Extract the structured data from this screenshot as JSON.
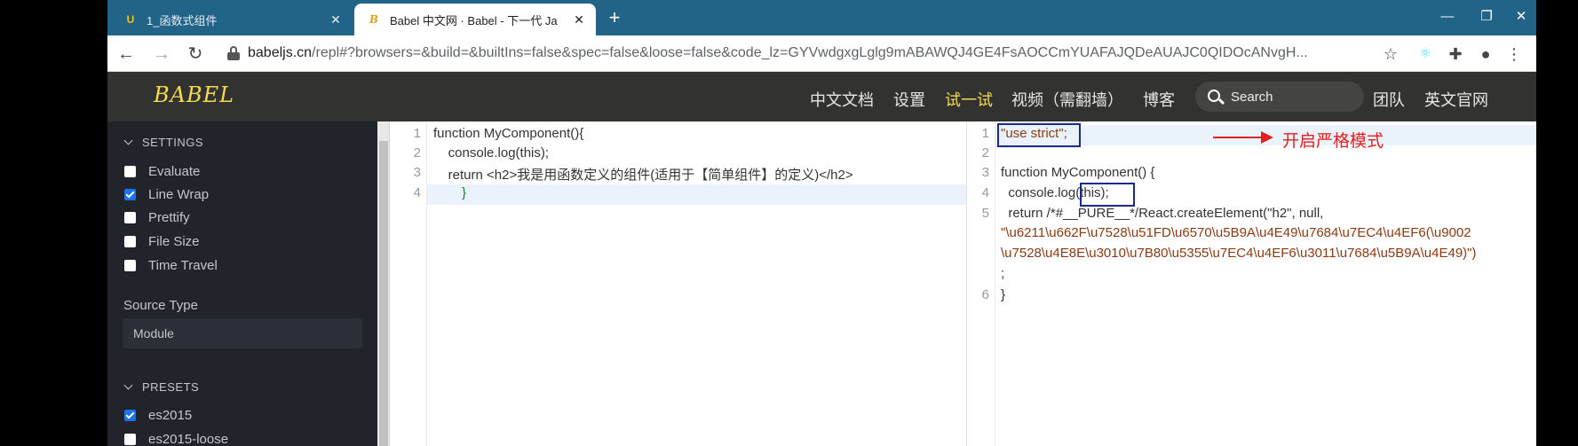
{
  "browser": {
    "tabs": [
      {
        "favicon": "U",
        "title": "1_函数式组件",
        "close": "✕"
      },
      {
        "favicon": "B",
        "title": "Babel 中文网 · Babel - 下一代 Ja",
        "close": "✕"
      }
    ],
    "new_tab": "+",
    "window_controls": {
      "minimize": "—",
      "restore": "❐",
      "close": "✕"
    },
    "url_host": "babeljs.cn",
    "url_path": "/repl#?browsers=&build=&builtIns=false&spec=false&loose=false&code_lz=GYVwdgxgLglg9mABAWQJ4GE4FsAOCCmYUAFAJQDeAUAJC0QIDOcANvgH..."
  },
  "site": {
    "logo": "BABEL",
    "nav": [
      "中文文档",
      "设置",
      "试一试",
      "视频（需翻墙）",
      "博客",
      "团队",
      "英文官网"
    ],
    "active_nav": "试一试",
    "search_placeholder": "Search"
  },
  "sidebar": {
    "settings_title": "SETTINGS",
    "settings": [
      {
        "label": "Evaluate",
        "checked": false
      },
      {
        "label": "Line Wrap",
        "checked": true
      },
      {
        "label": "Prettify",
        "checked": false
      },
      {
        "label": "File Size",
        "checked": false
      },
      {
        "label": "Time Travel",
        "checked": false
      }
    ],
    "source_type_label": "Source Type",
    "source_type_value": "Module",
    "presets_title": "PRESETS",
    "presets": [
      {
        "label": "es2015",
        "checked": true
      },
      {
        "label": "es2015-loose",
        "checked": false
      }
    ]
  },
  "input_editor": {
    "line_numbers": [
      "1",
      "2",
      "3",
      "4"
    ],
    "lines": [
      "function MyComponent(){",
      "    console.log(this);",
      "    return <h2>我是用函数定义的组件(适用于【简单组件】的定义)</h2>",
      "}"
    ]
  },
  "output_editor": {
    "line_numbers": [
      "1",
      "2",
      "3",
      "4",
      "5",
      "6"
    ],
    "lines": [
      "\"use strict\";",
      "",
      "function MyComponent() {",
      "  console.log(this);",
      "  return /*#__PURE__*/React.createElement(\"h2\", null,",
      "\"\\u6211\\u662F\\u7528\\u51FD\\u6570\\u5B9A\\u4E49\\u7684\\u7EC4\\u4EF6(\\u9002",
      "\\u7528\\u4E8E\\u3010\\u7B80\\u5355\\u7EC4\\u4EF6\\u3011\\u7684\\u5B9A\\u4E49)\")",
      ";",
      "}"
    ]
  },
  "annotation": {
    "text": "开启严格模式",
    "color": "#e02020",
    "box_color": "#1c2a8c"
  }
}
